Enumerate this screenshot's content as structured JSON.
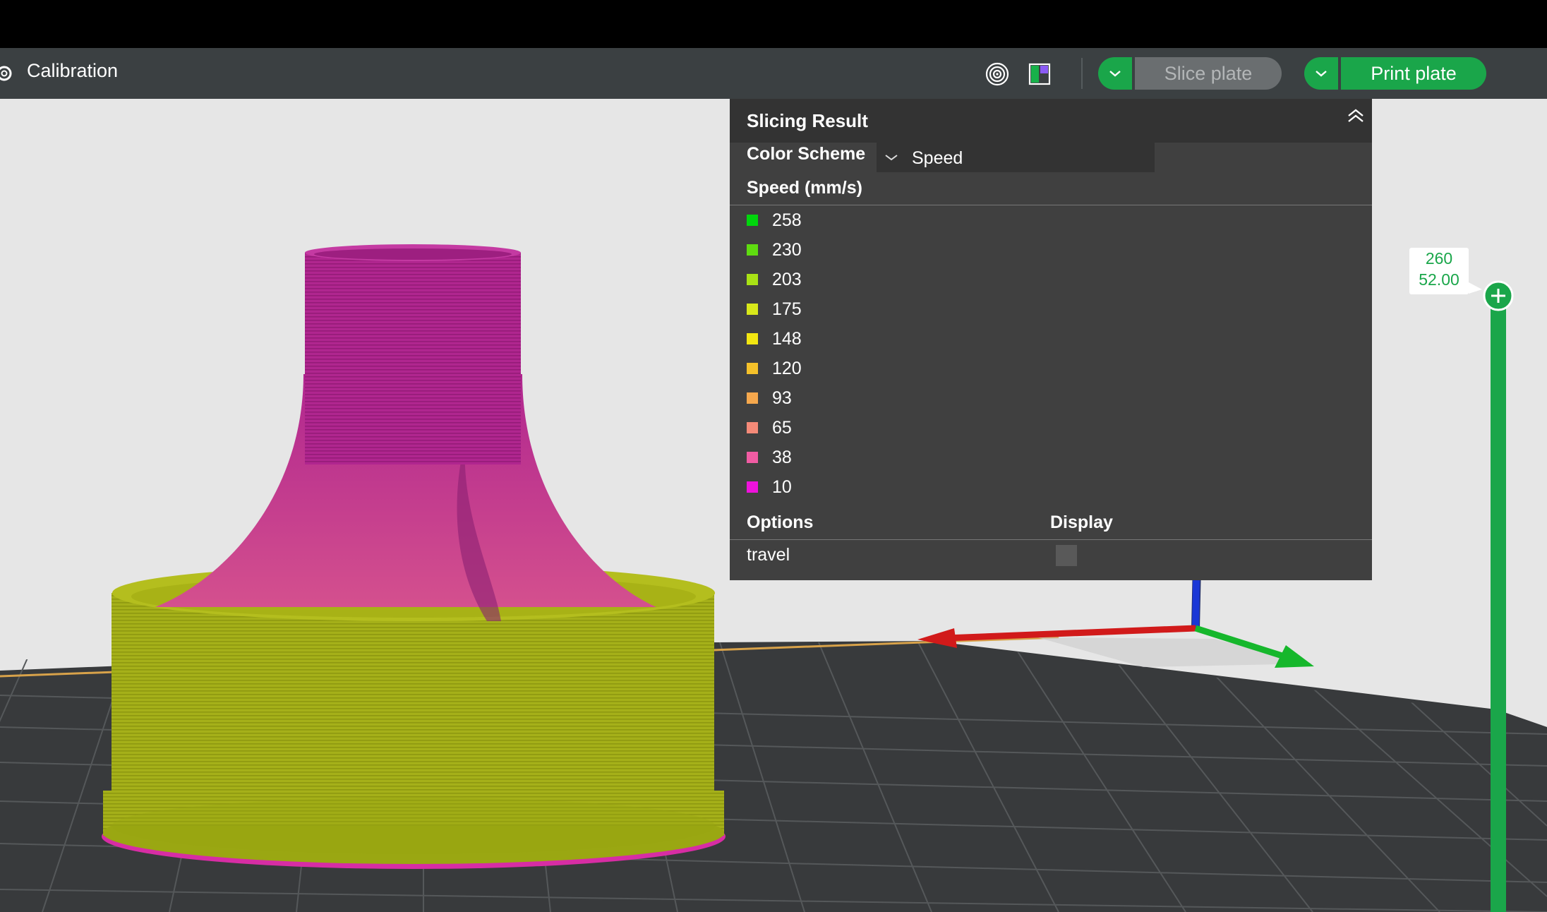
{
  "toolbar": {
    "title": "Calibration",
    "slice_label": "Slice plate",
    "print_label": "Print plate",
    "icons": [
      "gear-icon",
      "auto-orient-icon",
      "arrange-icon",
      "chevron-down-icon"
    ]
  },
  "panel": {
    "title": "Slicing Result",
    "color_scheme_label": "Color Scheme",
    "color_scheme_value": "Speed",
    "legend_title": "Speed (mm/s)",
    "legend": [
      {
        "value": "258",
        "color": "#00d60c"
      },
      {
        "value": "230",
        "color": "#5fdc10"
      },
      {
        "value": "203",
        "color": "#a9e215"
      },
      {
        "value": "175",
        "color": "#d8e81a"
      },
      {
        "value": "148",
        "color": "#f2e611"
      },
      {
        "value": "120",
        "color": "#f5c12a"
      },
      {
        "value": "93",
        "color": "#f6a84d"
      },
      {
        "value": "65",
        "color": "#f58a78"
      },
      {
        "value": "38",
        "color": "#f15ca3"
      },
      {
        "value": "10",
        "color": "#ee12dc"
      }
    ],
    "options_label": "Options",
    "display_label": "Display",
    "travel_label": "travel",
    "travel_checked": false
  },
  "layer_slider": {
    "layer": "260",
    "height": "52.00"
  },
  "colors": {
    "accent_green": "#1aa64a",
    "model_top": "#b0268f",
    "model_base": "#a9b417"
  }
}
